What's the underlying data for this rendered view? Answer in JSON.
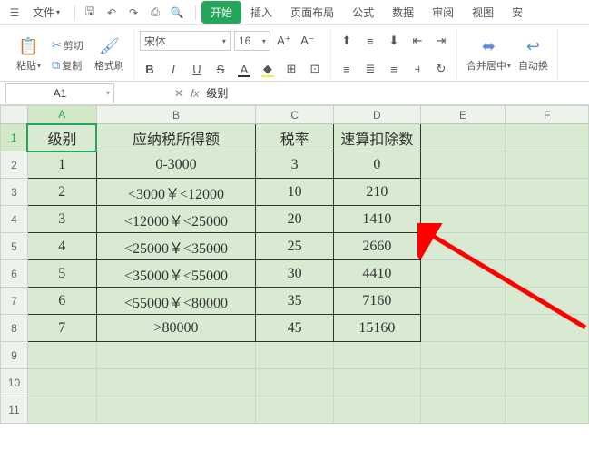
{
  "menubar": {
    "file": "文件",
    "tabs": [
      "开始",
      "插入",
      "页面布局",
      "公式",
      "数据",
      "审阅",
      "视图",
      "安"
    ]
  },
  "ribbon": {
    "cut": "剪切",
    "copy": "复制",
    "paste": "粘贴",
    "format_painter": "格式刷",
    "font_name": "宋体",
    "font_size": "16",
    "merge_center": "合并居中",
    "auto_wrap": "自动换"
  },
  "fbar": {
    "name_box": "A1",
    "formula": "级别"
  },
  "sheet": {
    "cols": [
      "A",
      "B",
      "C",
      "D",
      "E",
      "F"
    ],
    "active_col": "A",
    "active_row": 1,
    "headers": [
      "级别",
      "应纳税所得额",
      "税率",
      "速算扣除数"
    ],
    "rows": [
      [
        "1",
        "0-3000",
        "3",
        "0"
      ],
      [
        "2",
        "<3000￥<12000",
        "10",
        "210"
      ],
      [
        "3",
        "<12000￥<25000",
        "20",
        "1410"
      ],
      [
        "4",
        "<25000￥<35000",
        "25",
        "2660"
      ],
      [
        "5",
        "<35000￥<55000",
        "30",
        "4410"
      ],
      [
        "6",
        "<55000￥<80000",
        "35",
        "7160"
      ],
      [
        "7",
        ">80000",
        "45",
        "15160"
      ]
    ],
    "visible_rows": 11
  }
}
